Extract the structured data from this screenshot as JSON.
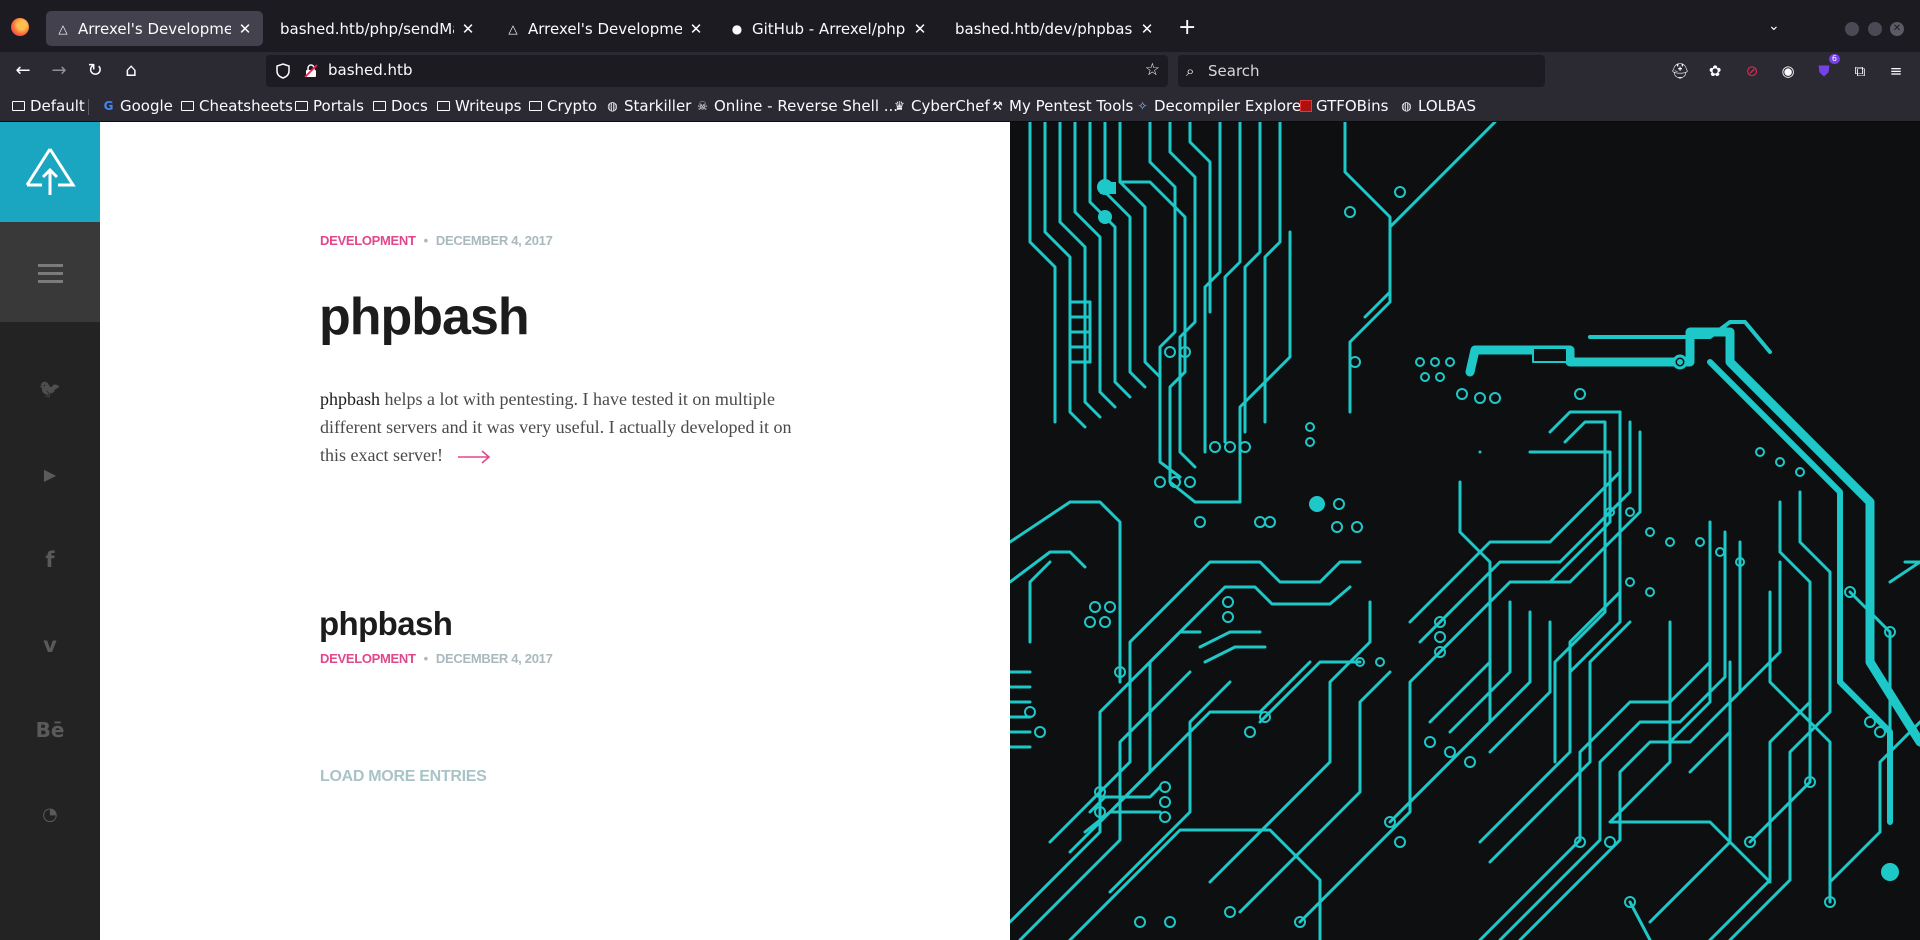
{
  "browser": {
    "tabs": [
      {
        "title": "Arrexel's Development Si",
        "icon": "arrexel-favicon",
        "active": true
      },
      {
        "title": "bashed.htb/php/sendMail.ph",
        "icon": "none",
        "active": false
      },
      {
        "title": "Arrexel's Development Si",
        "icon": "arrexel-favicon",
        "active": false
      },
      {
        "title": "GitHub - Arrexel/phpbash",
        "icon": "github-icon",
        "active": false
      },
      {
        "title": "bashed.htb/dev/phpbash.php",
        "icon": "none",
        "active": false
      }
    ],
    "url": "bashed.htb",
    "search_placeholder": "Search",
    "extension_badge": "6",
    "bookmarks": [
      {
        "label": "Default",
        "icon": "folder-icon"
      },
      {
        "label": "Google",
        "icon": "google-icon"
      },
      {
        "label": "Cheatsheets",
        "icon": "folder-icon"
      },
      {
        "label": "Portals",
        "icon": "folder-icon"
      },
      {
        "label": "Docs",
        "icon": "folder-icon"
      },
      {
        "label": "Writeups",
        "icon": "folder-icon"
      },
      {
        "label": "Crypto",
        "icon": "folder-icon"
      },
      {
        "label": "Starkiller",
        "icon": "globe-icon"
      },
      {
        "label": "Online - Reverse Shell ...",
        "icon": "skull-icon"
      },
      {
        "label": "CyberChef",
        "icon": "chef-icon"
      },
      {
        "label": "My Pentest Tools",
        "icon": "tools-icon"
      },
      {
        "label": "Decompiler Explorer",
        "icon": "decompiler-icon"
      },
      {
        "label": "GTFOBins",
        "icon": "gtfobins-icon"
      },
      {
        "label": "LOLBAS",
        "icon": "globe-icon"
      }
    ]
  },
  "site": {
    "social": [
      {
        "name": "twitter-icon",
        "glyph": "🐦"
      },
      {
        "name": "youtube-icon",
        "glyph": "▶"
      },
      {
        "name": "facebook-icon",
        "glyph": "f"
      },
      {
        "name": "vimeo-icon",
        "glyph": "v"
      },
      {
        "name": "behance-icon",
        "glyph": "Bē"
      },
      {
        "name": "rss-icon",
        "glyph": "◔"
      }
    ],
    "post1": {
      "category": "DEVELOPMENT",
      "date": "DECEMBER 4, 2017",
      "title": "phpbash",
      "excerpt_strong": "phpbash",
      "excerpt_rest": " helps a lot with pentesting. I have tested it on multiple different servers and it was very useful. I actually developed it on this exact server!"
    },
    "post2": {
      "title": "phpbash",
      "category": "DEVELOPMENT",
      "date": "DECEMBER 4, 2017"
    },
    "load_more": "LOAD MORE ENTRIES"
  },
  "colors": {
    "accent_pink": "#e0488b",
    "logo_teal": "#1aa5c0",
    "circuit": "#1fc8c8"
  }
}
